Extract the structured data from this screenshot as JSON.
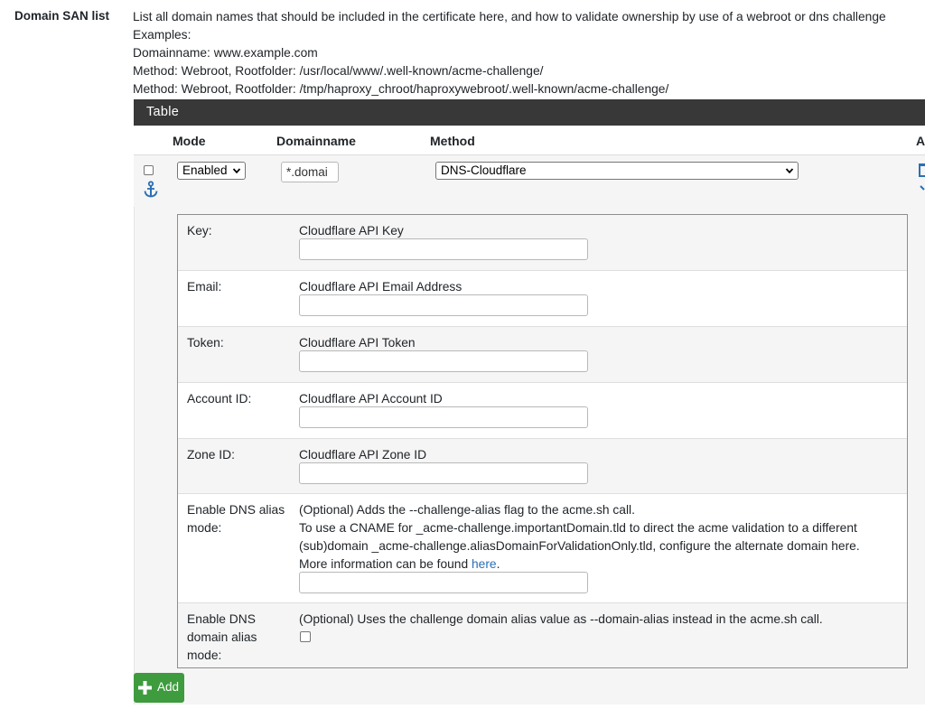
{
  "field": {
    "label": "Domain SAN list"
  },
  "help": {
    "lines": [
      "List all domain names that should be included in the certificate here, and how to validate ownership by use of a webroot or dns challenge",
      "Examples:",
      "Domainname: www.example.com",
      "Method: Webroot, Rootfolder: /usr/local/www/.well-known/acme-challenge/",
      "Method: Webroot, Rootfolder: /tmp/haproxy_chroot/haproxywebroot/.well-known/acme-challenge/"
    ]
  },
  "table": {
    "title": "Table",
    "columns": {
      "mode": "Mode",
      "domainname": "Domainname",
      "method": "Method",
      "actions": "A"
    },
    "row": {
      "mode_value": "Enabled",
      "domain_value": "*.domai",
      "method_value": "DNS-Cloudflare"
    }
  },
  "method_fields": {
    "key": {
      "label": "Key:",
      "description": "Cloudflare API Key"
    },
    "email": {
      "label": "Email:",
      "description": "Cloudflare API Email Address"
    },
    "token": {
      "label": "Token:",
      "description": "Cloudflare API Token"
    },
    "account_id": {
      "label": "Account ID:",
      "description": "Cloudflare API Account ID"
    },
    "zone_id": {
      "label": "Zone ID:",
      "description": "Cloudflare API Zone ID"
    },
    "dns_alias": {
      "label_line1": "Enable DNS alias",
      "label_line2": "mode:",
      "desc_line1": "(Optional) Adds the --challenge-alias flag to the acme.sh call.",
      "desc_line2": "To use a CNAME for _acme-challenge.importantDomain.tld to direct the acme validation to a different",
      "desc_line3": "(sub)domain _acme-challenge.aliasDomainForValidationOnly.tld, configure the alternate domain here.",
      "desc_line4_prefix": "More information can be found ",
      "desc_link": "here",
      "desc_line4_suffix": "."
    },
    "domain_alias": {
      "label_line1": "Enable DNS",
      "label_line2": "domain alias",
      "label_line3": "mode:",
      "description": "(Optional) Uses the challenge domain alias value as --domain-alias instead in the acme.sh call."
    }
  },
  "add_button": {
    "label": "Add"
  },
  "colors": {
    "header_bg": "#383838",
    "add_green": "#3e9b3e",
    "link": "#2b6fb5",
    "icon_blue": "#2b6fb5"
  },
  "icons": {
    "anchor": "anchor-icon",
    "trash": "trash-icon",
    "plus": "plus-icon",
    "chevron": "chevron-down-icon"
  }
}
